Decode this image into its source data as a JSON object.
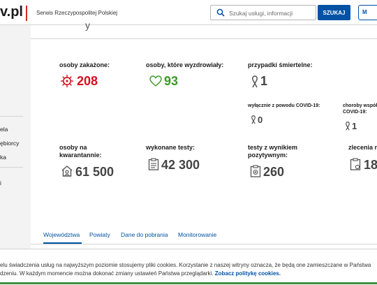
{
  "header": {
    "logo": "v.pl",
    "service_name": "Serwis Rzeczypospolitej Polskiej",
    "search_placeholder": "Szukaj usługi, informacji",
    "search_button": "SZUKAJ",
    "profile_button": "M"
  },
  "sidebar": {
    "items": [
      "ela",
      "ębiorcy",
      "ka",
      "i"
    ]
  },
  "stats": {
    "infected": {
      "label": "osoby zakażone:",
      "value": "208",
      "color": "#d4111e"
    },
    "recovered": {
      "label": "osoby, które wyzdrowiały:",
      "value": "93",
      "color": "#3d9a28"
    },
    "deaths": {
      "label": "przypadki śmiertelne:",
      "value": "1"
    },
    "deaths_covid": {
      "label": "wyłącznie z powodu COVID-19:",
      "value": "0"
    },
    "deaths_comorbid": {
      "label_line1": "choroby współ",
      "label_line2": "COVID-19:",
      "value": "1"
    },
    "quarantine": {
      "label_line1": "osoby na",
      "label_line2": "kwarantannie:",
      "value": "61 500"
    },
    "tests": {
      "label": "wykonane testy:",
      "value": "42 300"
    },
    "positive_tests": {
      "label_line1": "testy z wynikiem",
      "label_line2": "pozytywnym:",
      "value": "260"
    },
    "orders": {
      "label": "zlecenia n",
      "value": "18"
    }
  },
  "tabs": [
    "Województwa",
    "Powiaty",
    "Dane do pobrania",
    "Monitorowanie"
  ],
  "cookie": {
    "line1": "elu świadczenia usług na najwyższym poziomie stosujemy pliki cookies. Korzystanie z naszej witryny oznacza, że będą one zamieszczane w Państwa",
    "line2": "dzeniu. W każdym momencie można dokonać zmiany ustawień Państwa przeglądarki.",
    "link": "Zobacz politykę cookies."
  }
}
